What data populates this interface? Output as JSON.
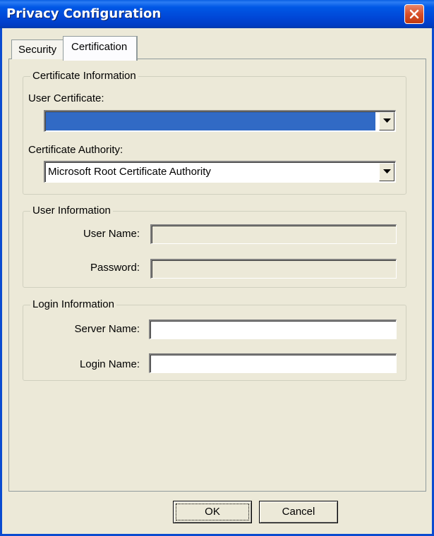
{
  "window": {
    "title": "Privacy Configuration",
    "close_icon": "close-icon",
    "titlebar_color": "#0054e3"
  },
  "tabs": [
    {
      "label": "Security",
      "selected": false
    },
    {
      "label": "Certification",
      "selected": true
    }
  ],
  "certificate_information": {
    "legend": "Certificate Information",
    "user_certificate": {
      "label": "User Certificate:",
      "value": ""
    },
    "certificate_authority": {
      "label": "Certificate Authority:",
      "value": "Microsoft Root Certificate Authority"
    }
  },
  "user_information": {
    "legend": "User Information",
    "user_name": {
      "label": "User Name:",
      "value": "",
      "enabled": false
    },
    "password": {
      "label": "Password:",
      "value": "",
      "enabled": false
    }
  },
  "login_information": {
    "legend": "Login Information",
    "server_name": {
      "label": "Server Name:",
      "value": ""
    },
    "login_name": {
      "label": "Login Name:",
      "value": ""
    }
  },
  "buttons": {
    "ok": "OK",
    "cancel": "Cancel"
  },
  "colors": {
    "selection": "#316ac5",
    "dialog_bg": "#ece9d8",
    "close_button": "#d84f2a"
  }
}
